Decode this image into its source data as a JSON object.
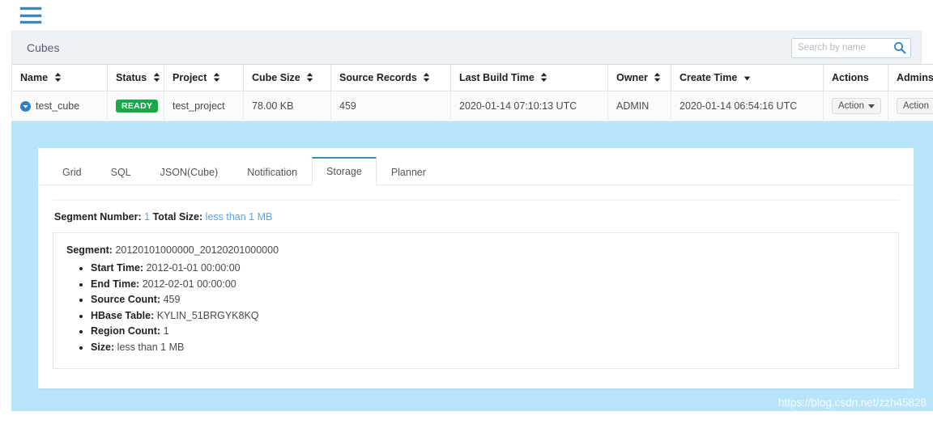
{
  "topbar": {
    "menu_icon": "hamburger-icon"
  },
  "panel": {
    "title": "Cubes",
    "search": {
      "placeholder": "Search by name",
      "value": "",
      "icon": "search-icon"
    }
  },
  "table": {
    "columns": [
      {
        "label": "Name",
        "sortable": true,
        "sort": "none"
      },
      {
        "label": "Status",
        "sortable": true,
        "sort": "none"
      },
      {
        "label": "Project",
        "sortable": true,
        "sort": "none"
      },
      {
        "label": "Cube Size",
        "sortable": true,
        "sort": "none"
      },
      {
        "label": "Source Records",
        "sortable": true,
        "sort": "none"
      },
      {
        "label": "Last Build Time",
        "sortable": true,
        "sort": "none"
      },
      {
        "label": "Owner",
        "sortable": true,
        "sort": "none"
      },
      {
        "label": "Create Time",
        "sortable": true,
        "sort": "desc"
      },
      {
        "label": "Actions",
        "sortable": false,
        "sort": "none"
      },
      {
        "label": "Admins",
        "sortable": false,
        "sort": "none"
      }
    ],
    "rows": [
      {
        "name": "test_cube",
        "expand_icon": "chevron-down-circle-icon",
        "status": "READY",
        "status_color": "#17a94a",
        "project": "test_project",
        "cube_size": "78.00 KB",
        "source_records": "459",
        "last_build_time": "2020-01-14 07:10:13 UTC",
        "owner": "ADMIN",
        "create_time": "2020-01-14 06:54:16 UTC",
        "actions_label": "Action",
        "admins_label": "Action"
      }
    ]
  },
  "detail": {
    "tabs": [
      {
        "label": "Grid",
        "active": false
      },
      {
        "label": "SQL",
        "active": false
      },
      {
        "label": "JSON(Cube)",
        "active": false
      },
      {
        "label": "Notification",
        "active": false
      },
      {
        "label": "Storage",
        "active": true
      },
      {
        "label": "Planner",
        "active": false
      }
    ],
    "storage": {
      "segment_number_label": "Segment Number:",
      "segment_number_value": "1",
      "total_size_label": "Total Size:",
      "total_size_value": "less than 1 MB",
      "segment": {
        "label": "Segment:",
        "id": "20120101000000_20120201000000",
        "items": [
          {
            "label": "Start Time:",
            "value": "2012-01-01 00:00:00"
          },
          {
            "label": "End Time:",
            "value": "2012-02-01 00:00:00"
          },
          {
            "label": "Source Count:",
            "value": "459"
          },
          {
            "label": "HBase Table:",
            "value": "KYLIN_51BRGYK8KQ"
          },
          {
            "label": "Region Count:",
            "value": "1"
          },
          {
            "label": "Size:",
            "value": "less than 1 MB"
          }
        ]
      }
    }
  },
  "watermark": {
    "text": "https://blog.csdn.net/zzh45828"
  },
  "colors": {
    "accent_blue": "#3c8dbc",
    "expanded_bg": "#b9e5fb",
    "status_green": "#17a94a",
    "link_blue": "#5ba4de",
    "header_bg": "#eef1f5"
  }
}
